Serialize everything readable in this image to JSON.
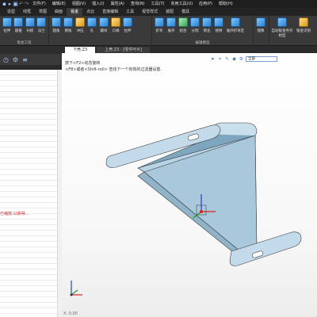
{
  "quick_access": [
    "new-icon",
    "open-icon",
    "save-icon",
    "undo-icon",
    "redo-icon"
  ],
  "menu": [
    "文件(F)",
    "编辑(E)",
    "视图(V)",
    "插入(I)",
    "属性(A)",
    "查询(N)",
    "工具(T)",
    "实用工具(U)",
    "应用(P)",
    "帮助(H)"
  ],
  "ribbon_tabs": [
    "造型",
    "线框",
    "草图",
    "曲面",
    "钣金",
    "点云",
    "直接编辑",
    "工具",
    "视觉样式",
    "装配",
    "模具"
  ],
  "ribbon_active_tab": "钣金",
  "ribbon_groups": [
    {
      "label": "钣金工程",
      "tools": [
        {
          "label": "拉伸",
          "label2": ""
        },
        {
          "label": "圆锥",
          "label2": ""
        },
        {
          "label": "扫掠",
          "label2": ""
        },
        {
          "label": "法兰",
          "label2": ""
        }
      ]
    },
    {
      "label": "",
      "tools": [
        {
          "label": "圆角",
          "label2": ""
        },
        {
          "label": "倒角",
          "label2": ""
        },
        {
          "label": "冲压",
          "label2": ""
        },
        {
          "label": "孔",
          "label2": ""
        },
        {
          "label": "螺纹",
          "label2": ""
        },
        {
          "label": "凸缘",
          "label2": ""
        },
        {
          "label": "拉伸",
          "label2": ""
        }
      ]
    },
    {
      "label": "",
      "tools": [
        {
          "label": "折弯",
          "label2": ""
        },
        {
          "label": "展开",
          "label2": ""
        },
        {
          "label": "组合",
          "label2": ""
        },
        {
          "label": "分割",
          "label2": ""
        },
        {
          "label": "简化",
          "label2": ""
        },
        {
          "label": "替换",
          "label2": ""
        },
        {
          "label": "展开折弯区",
          "label2": ""
        }
      ]
    },
    {
      "label": "编辑模型",
      "tools": [
        {
          "label": "镜像",
          "label2": ""
        }
      ]
    },
    {
      "label": "",
      "tools": [
        {
          "label": "自动钣金件开",
          "label2": "始型"
        },
        {
          "label": "钣金识别",
          "label2": ""
        }
      ]
    }
  ],
  "left_panel": {
    "error_text": "已缩放,以获得..."
  },
  "doc_tabs": [
    "下壳.Z3",
    "上壳.Z3 - [零件叶片]"
  ],
  "viewport": {
    "filter_value": "全部",
    "prompt_line1": "按下<F2>动态旋转",
    "prompt_line2": "<F8>或者<Shift-roll> 查找下一个有效的过滤器设置.",
    "coord_readout": "X: 0.00"
  },
  "colors": {
    "model_fill": "#b8d3e4",
    "model_edge": "#3a3a3a",
    "accent": "#2e7fd0",
    "axis_x": "#e02020",
    "axis_y": "#20a020",
    "axis_z": "#2040e0"
  }
}
